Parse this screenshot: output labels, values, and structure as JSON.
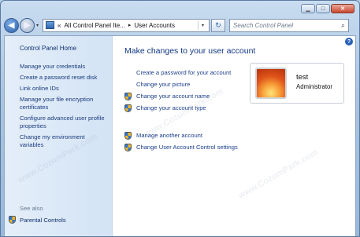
{
  "window": {
    "title_buttons": {
      "minimize": "▁",
      "maximize": "□",
      "close": "✕"
    }
  },
  "nav": {
    "back_glyph": "◀",
    "forward_glyph": "▶",
    "dropdown_glyph": "▾",
    "breadcrumb": {
      "overflow": "«",
      "items": [
        "All Control Panel Ite...",
        "User Accounts"
      ],
      "separator": "▸"
    },
    "refresh_glyph": "↻",
    "search_placeholder": "Search Control Panel",
    "search_icon": "⌕"
  },
  "left_pane": {
    "home": "Control Panel Home",
    "links": [
      "Manage your credentials",
      "Create a password reset disk",
      "Link online IDs",
      "Manage your file encryption certificates",
      "Configure advanced user profile properties",
      "Change my environment variables"
    ],
    "see_also_label": "See also",
    "see_also_items": [
      "Parental Controls"
    ]
  },
  "main": {
    "help_glyph": "?",
    "title": "Make changes to your user account",
    "links": [
      {
        "label": "Create a password for your account",
        "shield": false
      },
      {
        "label": "Change your picture",
        "shield": false
      },
      {
        "label": "Change your account name",
        "shield": true
      },
      {
        "label": "Change your account type",
        "shield": true
      }
    ],
    "links2": [
      {
        "label": "Manage another account",
        "shield": true
      },
      {
        "label": "Change User Account Control settings",
        "shield": true
      }
    ]
  },
  "user": {
    "name": "test",
    "role": "Administrator"
  },
  "watermark_text": "www.CozumPark.com",
  "colors": {
    "link": "#1b3f8a",
    "title": "#0f3683",
    "left_pane_bg": "#dbe8f7"
  }
}
